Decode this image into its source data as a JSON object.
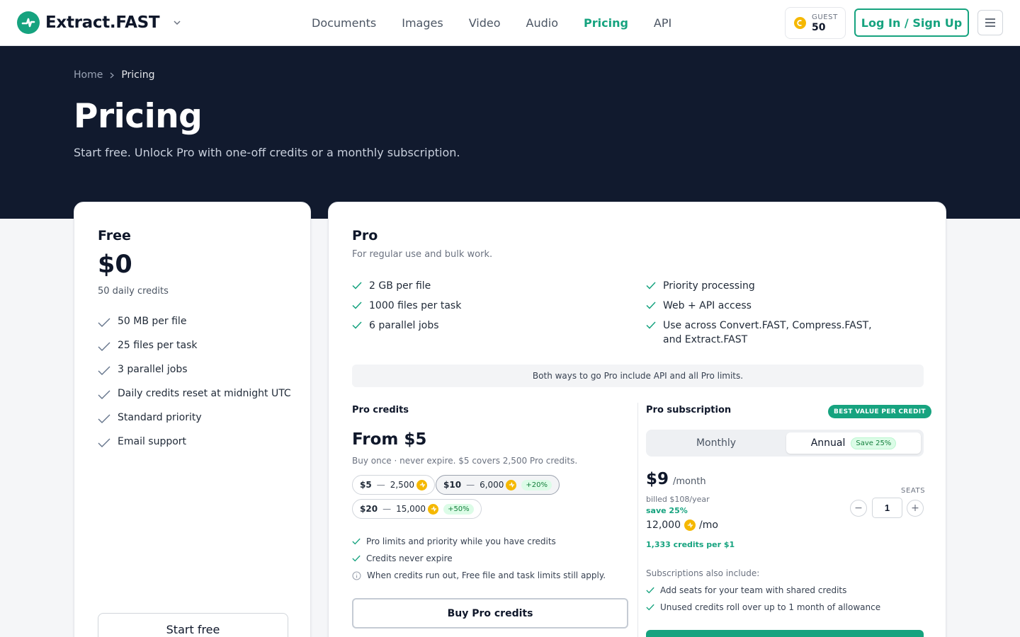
{
  "header": {
    "brand": "Extract.FAST",
    "nav": [
      "Documents",
      "Images",
      "Video",
      "Audio",
      "Pricing",
      "API"
    ],
    "active_nav": "Pricing",
    "guest_label": "GUEST",
    "guest_credits": "50",
    "login_label": "Log In / Sign Up"
  },
  "hero": {
    "breadcrumb_home": "Home",
    "breadcrumb_current": "Pricing",
    "title": "Pricing",
    "subtitle": "Start free. Unlock Pro with one-off credits or a monthly subscription."
  },
  "free": {
    "title": "Free",
    "price": "$0",
    "subtitle": "50 daily credits",
    "features": [
      "50 MB per file",
      "25 files per task",
      "3 parallel jobs",
      "Daily credits reset at midnight UTC",
      "Standard priority",
      "Email support"
    ],
    "cta": "Start free"
  },
  "pro": {
    "title": "Pro",
    "subtitle": "For regular use and bulk work.",
    "features_left": [
      "2 GB per file",
      "1000 files per task",
      "6 parallel jobs"
    ],
    "features_right": [
      "Priority processing",
      "Web + API access",
      "Use across Convert.FAST, Compress.FAST, and Extract.FAST"
    ],
    "both_ways": "Both ways to go Pro include API and all Pro limits.",
    "credits": {
      "heading": "Pro credits",
      "from": "From $5",
      "note": "Buy once · never expire. $5 covers 2,500 Pro credits.",
      "packs": [
        {
          "price": "$5",
          "credits": "2,500",
          "bonus": ""
        },
        {
          "price": "$10",
          "credits": "6,000",
          "bonus": "+20%"
        },
        {
          "price": "$20",
          "credits": "15,000",
          "bonus": "+50%"
        }
      ],
      "dash": "—",
      "benefit_1": "Pro limits and priority while you have credits",
      "benefit_2": "Credits never expire",
      "info": "When credits run out, Free file and task limits still apply.",
      "cta": "Buy Pro credits"
    },
    "subscription": {
      "heading": "Pro subscription",
      "badge": "BEST VALUE PER CREDIT",
      "monthly": "Monthly",
      "annual": "Annual",
      "save_pill": "Save 25%",
      "price": "$9",
      "per": "/month",
      "billed": "billed $108/year",
      "save": "save 25%",
      "credits": "12,000",
      "credits_per": "/mo",
      "per_dollar": "1,333 credits per $1",
      "seats_label": "SEATS",
      "seats": "1",
      "minus": "−",
      "plus": "+",
      "also": "Subscriptions also include:",
      "includes": [
        "Add seats for your team with shared credits",
        "Unused credits roll over up to 1 month of allowance"
      ]
    }
  },
  "colors": {
    "accent": "#16a37f",
    "hero_bg": "#111a2e",
    "coin": "#f5b800"
  }
}
